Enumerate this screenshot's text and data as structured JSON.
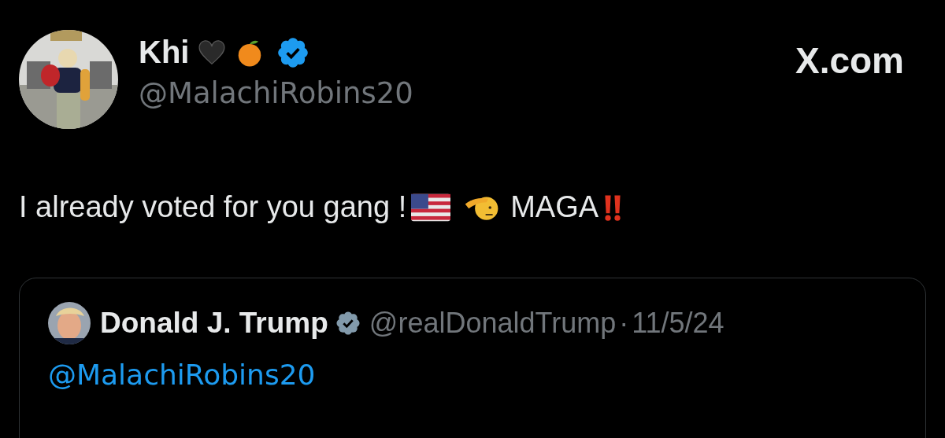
{
  "header": {
    "brand": "X.com"
  },
  "author": {
    "name": "Khi",
    "handle": "@MalachiRobins20",
    "color": "#1d9bf0"
  },
  "post": {
    "text": "I already voted for you gang !",
    "tag": "MAGA"
  },
  "quoted_post": {
    "author": {
      "name": "Donald J. Trump",
      "handle": "@realDonaldTrump",
      "color": "#829aab"
    },
    "separator": "·",
    "date": "11/5/24",
    "text": "@MalachiRobins20"
  }
}
